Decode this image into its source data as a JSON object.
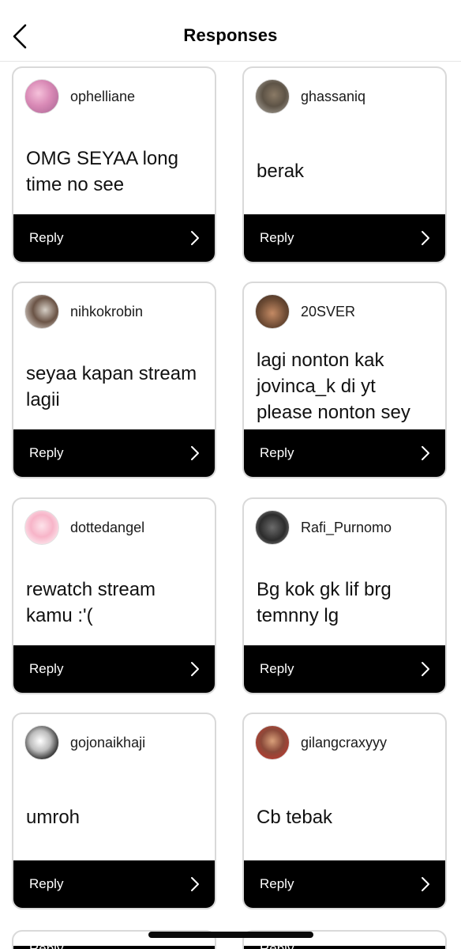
{
  "header": {
    "title": "Responses"
  },
  "responses": [
    {
      "username": "ophelliane",
      "message": "OMG SEYAA long time no see",
      "reply_label": "Reply"
    },
    {
      "username": "ghassaniq",
      "message": "berak",
      "reply_label": "Reply"
    },
    {
      "username": "nihkokrobin",
      "message": "seyaa kapan stream lagii",
      "reply_label": "Reply"
    },
    {
      "username": "20SVER",
      "message": "lagi nonton kak jovinca_k di yt please nonton sey",
      "reply_label": "Reply"
    },
    {
      "username": "dottedangel",
      "message": "rewatch stream kamu :'(",
      "reply_label": "Reply"
    },
    {
      "username": "Rafi_Purnomo",
      "message": "Bg kok gk lif brg temnny lg",
      "reply_label": "Reply"
    },
    {
      "username": "gojonaikhaji",
      "message": "umroh",
      "reply_label": "Reply"
    },
    {
      "username": "gilangcraxyyy",
      "message": "Cb tebak",
      "reply_label": "Reply"
    }
  ],
  "partial_row": {
    "left_label": "Reply",
    "right_label": "Reply"
  }
}
